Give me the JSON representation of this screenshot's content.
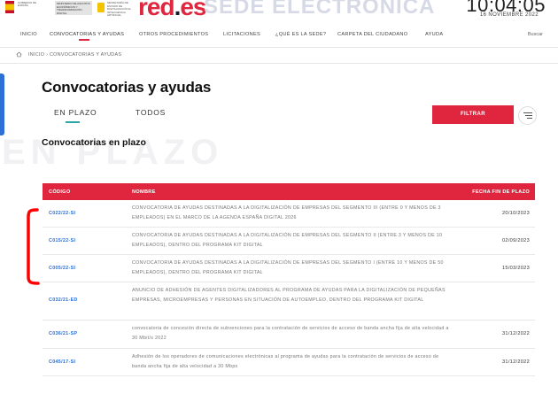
{
  "header": {
    "gov_text": "GOBIERNO DE ESPAÑA",
    "ministry_text": "MINISTERIO DE ASUNTOS ECONÓMICOS Y TRANSFORMACIÓN DIGITAL",
    "secretaria_text": "SECRETARÍA DE ESTADO DE DIGITALIZACIÓN E INTELIGENCIA ARTIFICIAL",
    "brand": "red",
    "brand_dot": ".",
    "brand_suffix": "es",
    "sede": "SEDE ELECTRÓNICA",
    "time": "10:04:05",
    "date": "16 NOVIEMBRE 2022"
  },
  "nav": {
    "items": [
      "INICIO",
      "CONVOCATORIAS Y AYUDAS",
      "OTROS PROCEDIMIENTOS",
      "LICITACIONES",
      "¿QUÉ ES LA SEDE?",
      "CARPETA DEL CIUDADANO",
      "AYUDA"
    ],
    "search": "Buscar"
  },
  "breadcrumb": {
    "text": "INICIO  ›  CONVOCATORIAS Y AYUDAS"
  },
  "main": {
    "title": "Convocatorias y ayudas",
    "tabs": [
      "EN PLAZO",
      "TODOS"
    ],
    "filter_button": "FILTRAR",
    "section_title": "Convocatorias en plazo",
    "watermark": "EN PLAZO"
  },
  "table": {
    "headers": [
      "CÓDIGO",
      "NOMBRE",
      "FECHA FIN DE PLAZO"
    ],
    "rows": [
      {
        "code": "C022/22-SI",
        "name": "CONVOCATORIA DE AYUDAS DESTINADAS A LA DIGITALIZACIÓN DE EMPRESAS DEL SEGMENTO III (ENTRE 0 Y MENOS DE 3 EMPLEADOS) EN EL MARCO DE LA AGENDA ESPAÑA DIGITAL 2026",
        "date": "20/10/2023"
      },
      {
        "code": "C015/22-SI",
        "name": "CONVOCATORIA DE AYUDAS DESTINADAS A LA DIGITALIZACIÓN DE EMPRESAS DEL SEGMENTO II (ENTRE 3 Y MENOS DE 10 EMPLEADOS), DENTRO DEL PROGRAMA KIT DIGITAL",
        "date": "02/09/2023"
      },
      {
        "code": "C005/22-SI",
        "name": "CONVOCATORIA DE AYUDAS DESTINADAS A LA DIGITALIZACIÓN DE EMPRESAS DEL SEGMENTO I (ENTRE 10 Y MENOS DE 50 EMPLEADOS), DENTRO DEL PROGRAMA KIT DIGITAL",
        "date": "15/03/2023"
      },
      {
        "code": "C032/21-ED",
        "name": "ANUNCIO DE ADHESIÓN DE AGENTES DIGITALIZADORES AL PROGRAMA DE AYUDAS PARA LA DIGITALIZACIÓN DE PEQUEÑAS EMPRESAS, MICROEMPRESAS Y PERSONAS EN SITUACIÓN DE AUTOEMPLEO, DENTRO DEL PROGRAMA KIT DIGITAL",
        "date": ""
      },
      {
        "code": "C036/21-SP",
        "name": "convocatoria de concesión directa de subvenciones para la contratación de servicios de acceso de banda ancha fija de alta velocidad a 30 Mbit/s 2022",
        "date": "31/12/2022"
      },
      {
        "code": "C045/17-SI",
        "name": "Adhesión de los operadores de comunicaciones electrónicas al programa de ayudas para la contratación de servicios de acceso de banda ancha fija de alta velocidad a 30 Mbps",
        "date": "31/12/2022"
      }
    ]
  },
  "colors": {
    "accent": "#e0263e",
    "link": "#2c6fd6",
    "tab_underline": "#2aa6a8",
    "annotation": "#ff0000"
  }
}
